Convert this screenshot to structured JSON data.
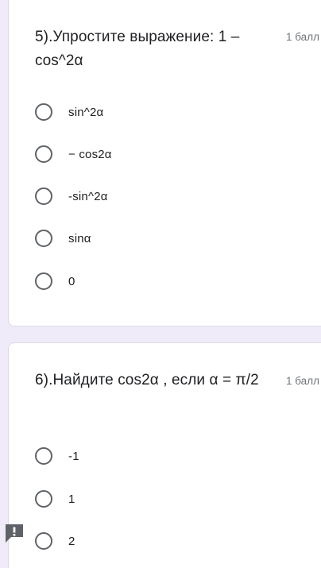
{
  "questions": [
    {
      "title": "5).Упростите выражение: 1 – cos^2α",
      "points": "1 балл",
      "options": [
        "sin^2α",
        "− cos2α",
        "-sin^2α",
        "sinα",
        "0"
      ]
    },
    {
      "title": "6).Найдите cos2α , если α = π/2",
      "points": "1 балл",
      "options": [
        "-1",
        "1",
        "2"
      ]
    }
  ],
  "icons": {
    "report": "report-problem-icon"
  },
  "colors": {
    "background": "#f0ebf8",
    "radio_border": "#5f6368",
    "text": "#202124",
    "points_text": "#70757a"
  }
}
